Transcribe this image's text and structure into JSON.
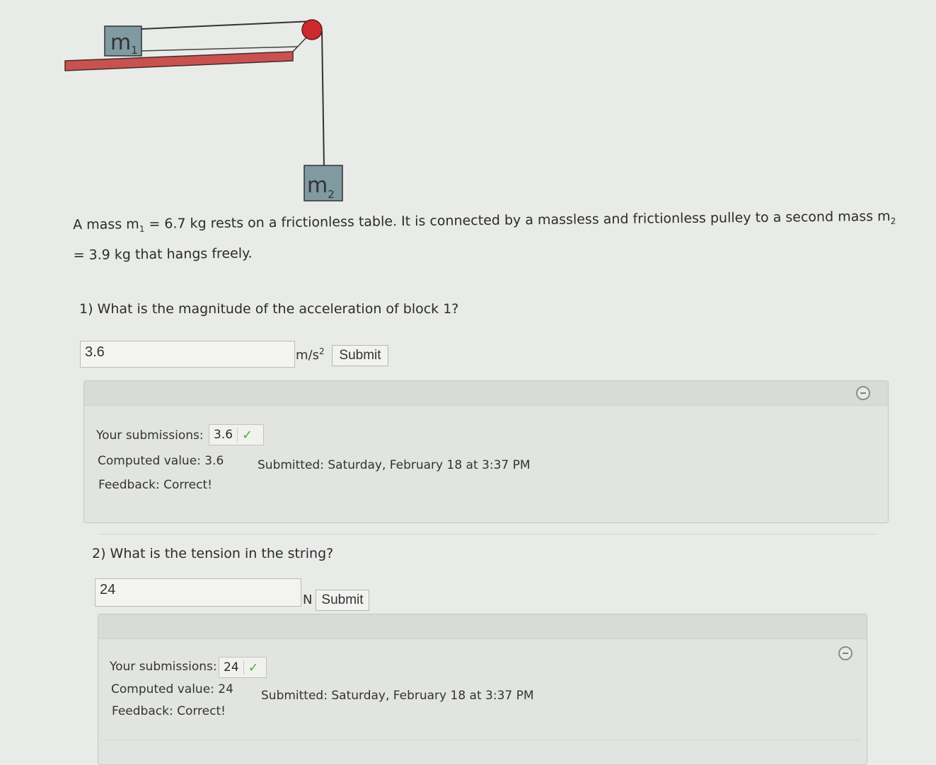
{
  "diagram": {
    "mass1_label": "m",
    "mass1_sub": "1",
    "mass2_label": "m",
    "mass2_sub": "2"
  },
  "problem": {
    "part1": "A mass m",
    "sub1": "1",
    "part2": " = 6.7 kg rests on a frictionless table. It is connected by a massless and frictionless pulley to a second mass m",
    "sub2": "2",
    "part3": "= 3.9 kg that hangs freely."
  },
  "questions": [
    {
      "prompt": "1) What is the magnitude of the acceleration of block 1?",
      "input_value": "3.6",
      "unit": "m/s",
      "unit_sup": "2",
      "submit_label": "Submit",
      "submissions_label": "Your submissions:",
      "submission_value": "3.6",
      "computed_label": "Computed value:",
      "computed_value": "3.6",
      "feedback_label": "Feedback:",
      "feedback_value": "Correct!",
      "submitted_label": "Submitted:",
      "submitted_value": "Saturday, February 18 at 3:37 PM"
    },
    {
      "prompt": "2) What is the tension in the string?",
      "input_value": "24",
      "unit": "N",
      "submit_label": "Submit",
      "submissions_label": "Your submissions:",
      "submission_value": "24",
      "computed_label": "Computed value:",
      "computed_value": "24",
      "feedback_label": "Feedback:",
      "feedback_value": "Correct!",
      "submitted_label": "Submitted:",
      "submitted_value": "Saturday, February 18 at 3:37 PM"
    }
  ],
  "icons": {
    "check": "check-icon",
    "collapse": "minus-circle-icon"
  },
  "colors": {
    "table": "#c8524f",
    "pulley": "#cc2a2e",
    "block": "#7f9aa0",
    "check": "#4caf3c"
  }
}
